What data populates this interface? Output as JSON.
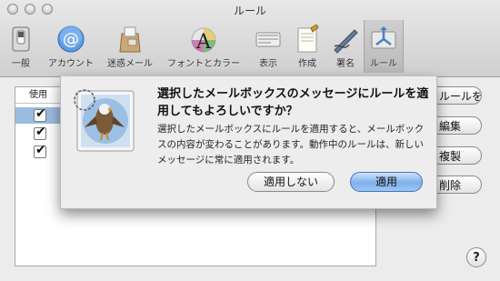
{
  "window": {
    "title": "ルール"
  },
  "toolbar": {
    "items": [
      {
        "label": "一般",
        "icon": "switch-icon"
      },
      {
        "label": "アカウント",
        "icon": "at-sign-icon"
      },
      {
        "label": "迷惑メール",
        "icon": "junk-mail-bag-icon"
      },
      {
        "label": "フォントとカラー",
        "icon": "font-color-icon"
      },
      {
        "label": "表示",
        "icon": "display-icon"
      },
      {
        "label": "作成",
        "icon": "compose-icon"
      },
      {
        "label": "署名",
        "icon": "signature-pen-icon"
      },
      {
        "label": "ルール",
        "icon": "rules-icon"
      }
    ],
    "selected": "ルール"
  },
  "rules_table": {
    "column_header": "使用",
    "rows": [
      {
        "checked": true,
        "selected": true
      },
      {
        "checked": true,
        "selected": false
      },
      {
        "checked": true,
        "selected": false
      }
    ]
  },
  "side_buttons": {
    "add": "ルールを追加",
    "edit": "編集",
    "duplicate": "複製",
    "remove": "削除"
  },
  "help": {
    "label": "?"
  },
  "sheet": {
    "title": "選択したメールボックスのメッセージにルールを適用してもよろしいですか？",
    "message": "選択したメールボックスにルールを適用すると、メールボックスの内容が変わることがあります。動作中のルールは、新しいメッセージに常に適用されます。",
    "buttons": {
      "cancel": "適用しない",
      "apply": "適用"
    }
  },
  "colors": {
    "accent": "#7fb0ec",
    "selection": "#9bbbe0"
  }
}
